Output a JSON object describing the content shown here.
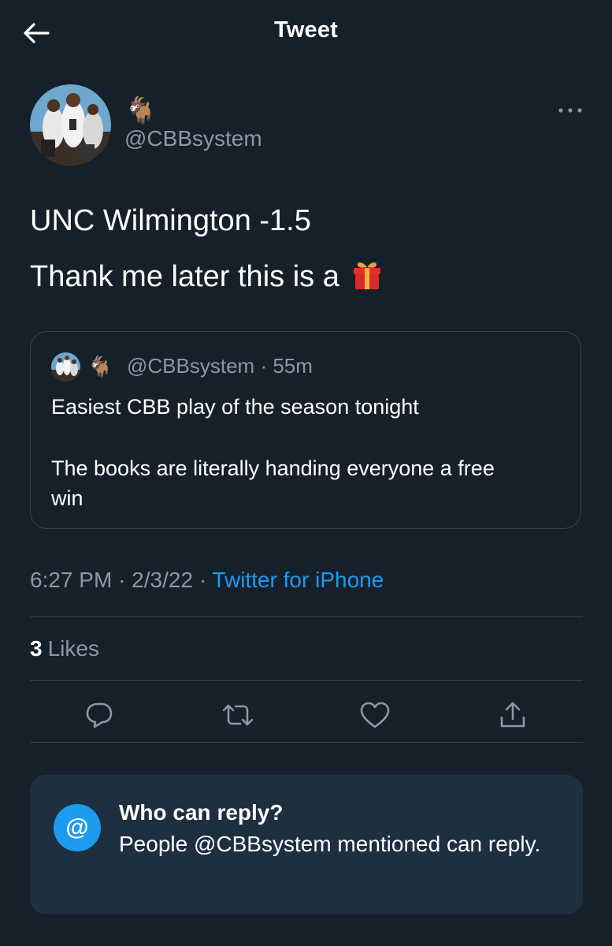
{
  "header": {
    "title": "Tweet",
    "back_icon": "arrow-left-icon"
  },
  "author": {
    "display_name": "🐐",
    "handle": "@CBBsystem",
    "more_icon": "more-horizontal-icon"
  },
  "tweet": {
    "line1": "UNC Wilmington -1.5",
    "line2": "Thank me later this is a",
    "line2_icon": "gift-icon"
  },
  "quoted_tweet": {
    "display_name": "🐐",
    "handle": "@CBBsystem",
    "time": "55m",
    "separator": "·",
    "text_line1": "Easiest CBB play of the season tonight",
    "text_line2": "The books are literally handing everyone a free",
    "text_line3": "win"
  },
  "meta": {
    "time": "6:27 PM",
    "date": "2/3/22",
    "separator": "·",
    "source": "Twitter for iPhone"
  },
  "stats": {
    "likes_count": "3",
    "likes_label": "Likes"
  },
  "actions": [
    {
      "icon": "reply-icon"
    },
    {
      "icon": "retweet-icon"
    },
    {
      "icon": "heart-icon"
    },
    {
      "icon": "share-icon"
    }
  ],
  "who_can_reply": {
    "icon_text": "@",
    "title": "Who can reply?",
    "description": "People @CBBsystem mentioned can reply."
  },
  "colors": {
    "background": "#15202b",
    "accent": "#1d9bf0",
    "secondary_text": "#8b98a5",
    "divider": "#38444d",
    "reply_box": "#1e2f40"
  }
}
